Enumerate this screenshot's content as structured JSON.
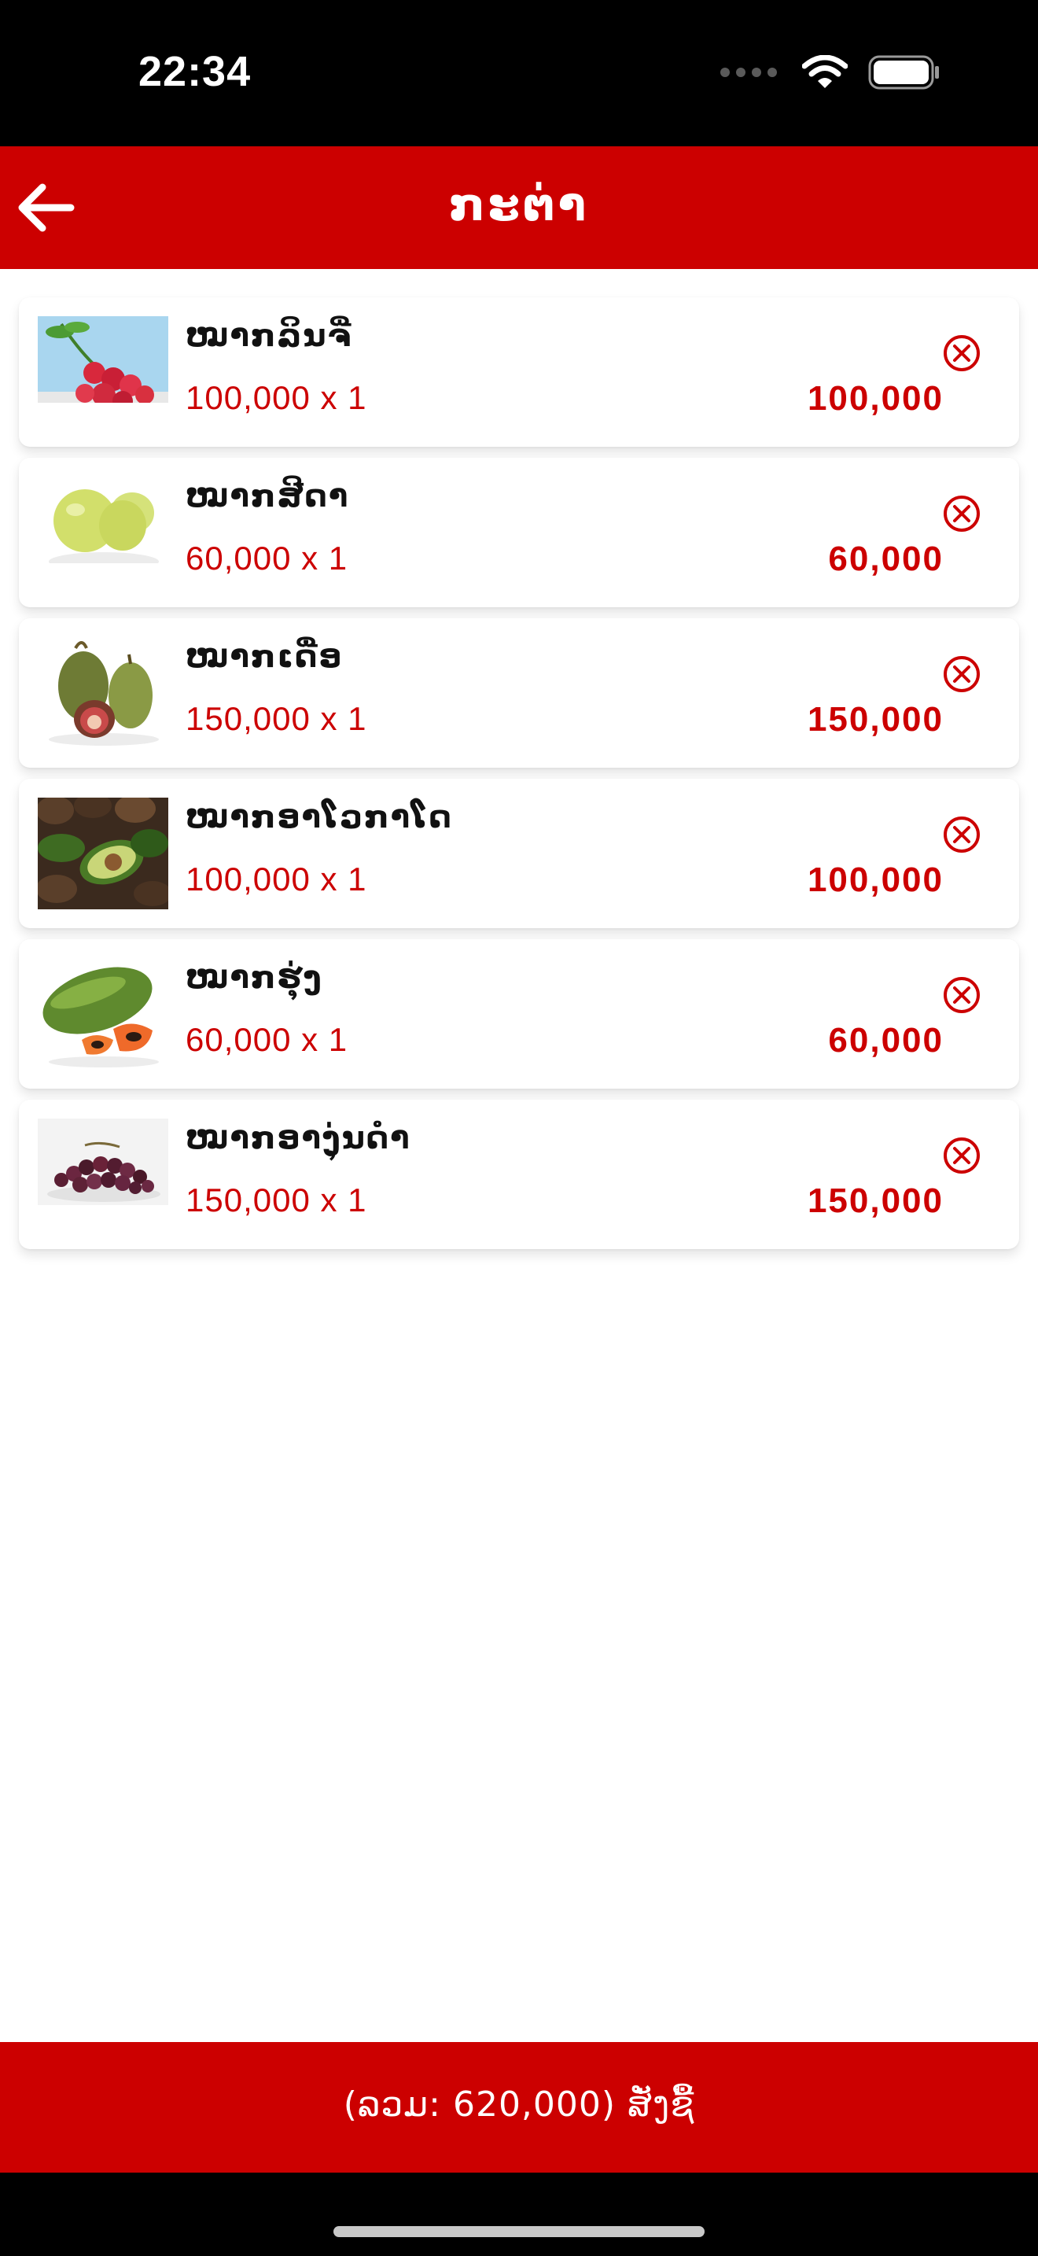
{
  "status_bar": {
    "time": "22:34",
    "icons": [
      "cellular-dots-icon",
      "wifi-icon",
      "battery-icon"
    ]
  },
  "header": {
    "title": "ກະຕ່າ",
    "back_icon": "arrow-left-icon"
  },
  "colors": {
    "accent": "#cc0000",
    "text": "#111111",
    "background": "#ffffff"
  },
  "cart": {
    "items": [
      {
        "name": "ໝາກລິນຈີ່",
        "qty_price": "100,000 x 1",
        "total": "100,000",
        "image": "lychee"
      },
      {
        "name": "ໝາກສີດາ",
        "qty_price": "60,000 x 1",
        "total": "60,000",
        "image": "guava"
      },
      {
        "name": "ໝາກເດື່ອ",
        "qty_price": "150,000 x 1",
        "total": "150,000",
        "image": "fig"
      },
      {
        "name": "ໝາກອາໂວກາໂດ",
        "qty_price": "100,000 x 1",
        "total": "100,000",
        "image": "avocado"
      },
      {
        "name": "ໝາກຮຸ່ງ",
        "qty_price": "60,000 x 1",
        "total": "60,000",
        "image": "papaya"
      },
      {
        "name": "ໝາກອາງຸ່ນດໍາ",
        "qty_price": "150,000 x 1",
        "total": "150,000",
        "image": "black-grapes"
      }
    ]
  },
  "checkout": {
    "label": "(ລວມ: 620,000) ສັ່ງຊື້"
  }
}
